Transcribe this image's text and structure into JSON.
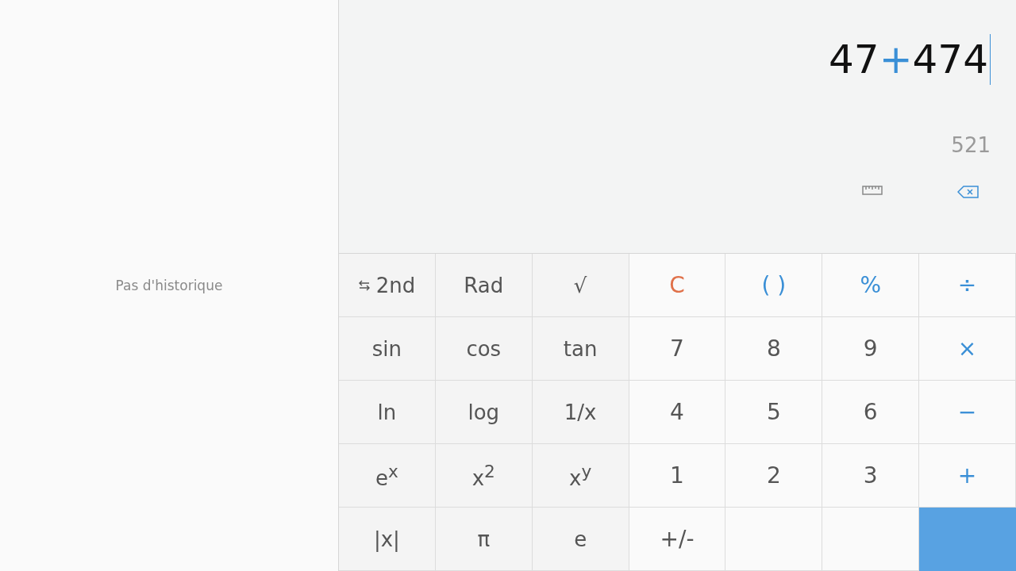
{
  "history": {
    "empty_text": "Pas d'historique"
  },
  "display": {
    "expression": [
      {
        "text": "47",
        "kind": "number"
      },
      {
        "text": "+",
        "kind": "operator"
      },
      {
        "text": "474",
        "kind": "number"
      }
    ],
    "result": "521"
  },
  "keys": [
    {
      "text": "2nd",
      "kind": "toggle"
    },
    {
      "text": "Rad",
      "kind": "scientific"
    },
    {
      "text": "√",
      "kind": "scientific"
    },
    {
      "text": "C",
      "kind": "clear"
    },
    {
      "text": "( )",
      "kind": "operator"
    },
    {
      "text": "%",
      "kind": "operator"
    },
    {
      "text": "÷",
      "kind": "operator"
    },
    {
      "text": "sin",
      "kind": "scientific"
    },
    {
      "text": "cos",
      "kind": "scientific"
    },
    {
      "text": "tan",
      "kind": "scientific"
    },
    {
      "text": "7",
      "kind": "number"
    },
    {
      "text": "8",
      "kind": "number"
    },
    {
      "text": "9",
      "kind": "number"
    },
    {
      "text": "×",
      "kind": "operator"
    },
    {
      "text": "ln",
      "kind": "scientific"
    },
    {
      "text": "log",
      "kind": "scientific"
    },
    {
      "text": "1/x",
      "kind": "scientific"
    },
    {
      "text": "4",
      "kind": "number"
    },
    {
      "text": "5",
      "kind": "number"
    },
    {
      "text": "6",
      "kind": "number"
    },
    {
      "text": "−",
      "kind": "operator"
    },
    {
      "text": "e$^{x}$",
      "kind": "scientific"
    },
    {
      "text": "x$^{2}$",
      "kind": "scientific"
    },
    {
      "text": "x$^{y}$",
      "kind": "scientific"
    },
    {
      "text": "1",
      "kind": "number"
    },
    {
      "text": "2",
      "kind": "number"
    },
    {
      "text": "3",
      "kind": "number"
    },
    {
      "text": "+",
      "kind": "operator"
    },
    {
      "text": "|x|",
      "kind": "scientific"
    },
    {
      "text": "π",
      "kind": "scientific"
    },
    {
      "text": "e",
      "kind": "scientific"
    },
    {
      "text": "+/-",
      "kind": "number"
    },
    {
      "kind": "blank"
    },
    {
      "kind": "blank"
    },
    {
      "kind": "equals"
    }
  ]
}
